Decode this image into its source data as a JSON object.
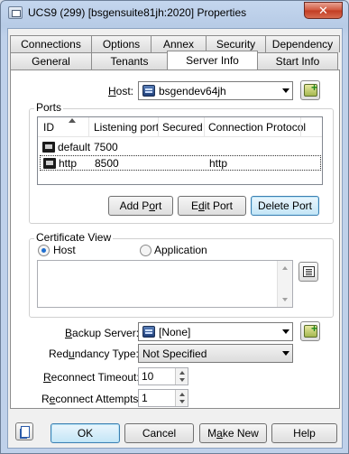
{
  "window": {
    "title": "UCS9 (299) [bsgensuite81jh:2020] Properties",
    "close_glyph": "✕"
  },
  "tabs_row1": [
    "Connections",
    "Options",
    "Annex",
    "Security",
    "Dependency"
  ],
  "tabs_row2": [
    "General",
    "Tenants",
    "Server Info",
    "Start Info"
  ],
  "active_tab": "Server Info",
  "host": {
    "label": "Host:",
    "value": "bsgendev64jh"
  },
  "ports": {
    "group_title": "Ports",
    "columns": [
      "ID",
      "Listening port",
      "Secured",
      "Connection Protocol"
    ],
    "rows": [
      {
        "id": "default",
        "port": "7500",
        "secured": "",
        "protocol": ""
      },
      {
        "id": "http",
        "port": "8500",
        "secured": "",
        "protocol": "http"
      }
    ],
    "add_label": "Add Port",
    "edit_label": "Edit Port",
    "delete_label": "Delete Port"
  },
  "certificate": {
    "group_title": "Certificate View",
    "host_label": "Host",
    "application_label": "Application",
    "selected": "Host"
  },
  "backup_server": {
    "label": "Backup Server:",
    "value": "[None]"
  },
  "redundancy": {
    "label": "Redundancy Type:",
    "value": "Not Specified"
  },
  "reconnect_timeout": {
    "label": "Reconnect Timeout:",
    "value": "10"
  },
  "reconnect_attempts": {
    "label": "Reconnect Attempts:",
    "value": "1"
  },
  "footer": {
    "ok": "OK",
    "cancel": "Cancel",
    "make_new": "Make New",
    "help": "Help"
  }
}
